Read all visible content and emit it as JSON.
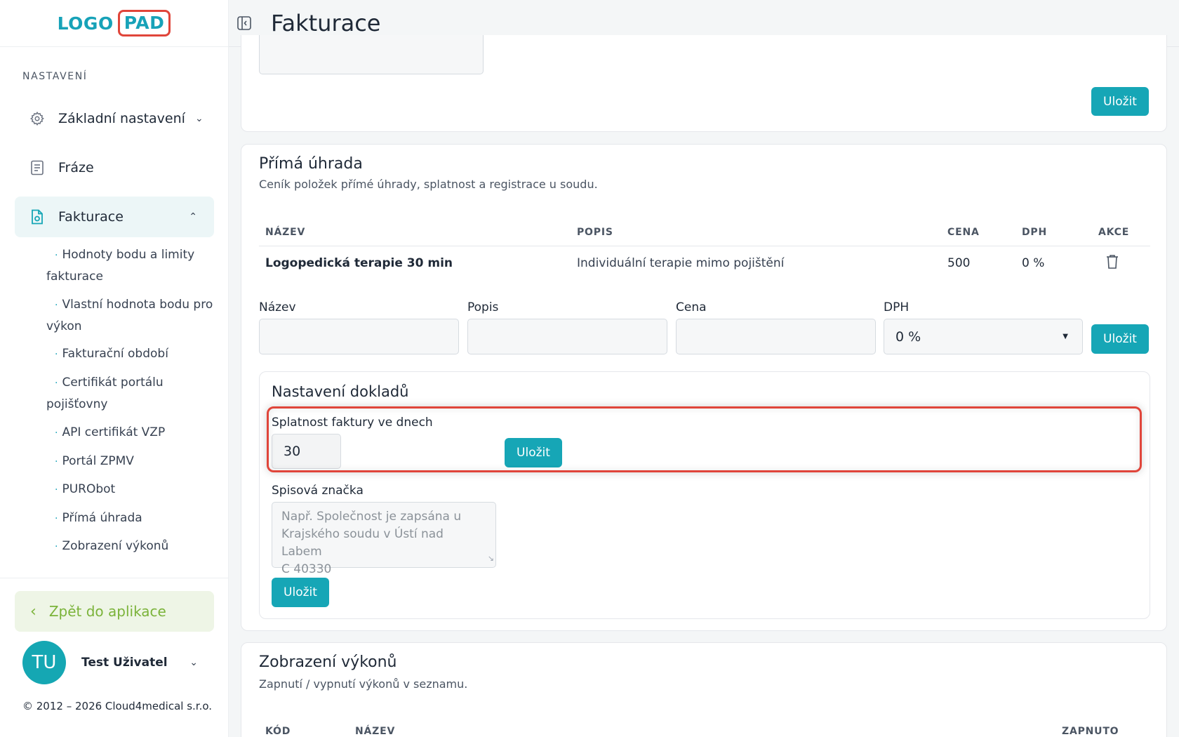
{
  "logo": {
    "part1": "LOGO",
    "part2": "PAD"
  },
  "sidebar": {
    "section_label": "NASTAVENÍ",
    "items": [
      {
        "label": "Základní nastavení",
        "icon": "gear-icon"
      },
      {
        "label": "Fráze",
        "icon": "document-icon"
      },
      {
        "label": "Fakturace",
        "icon": "invoice-icon"
      }
    ],
    "sub_items": [
      {
        "line1": "Hodnoty bodu a limity",
        "line2": "fakturace"
      },
      {
        "line1": "Vlastní hodnota bodu pro",
        "line2": "výkon"
      },
      {
        "line1": "Fakturační období",
        "line2": ""
      },
      {
        "line1": "Certifikát portálu",
        "line2": "pojišťovny"
      },
      {
        "line1": "API certifikát VZP",
        "line2": ""
      },
      {
        "line1": "Portál ZPMV",
        "line2": ""
      },
      {
        "line1": "PURObot",
        "line2": ""
      },
      {
        "line1": "Přímá úhrada",
        "line2": ""
      },
      {
        "line1": "Zobrazení výkonů",
        "line2": ""
      }
    ],
    "back_label": "Zpět do aplikace",
    "user": {
      "initials": "TU",
      "name": "Test Uživatel"
    },
    "copyright": "© 2012 – 2026 Cloud4medical s.r.o."
  },
  "header": {
    "title": "Fakturace"
  },
  "top_card": {
    "save_label": "Uložit"
  },
  "prima_uhrada": {
    "title": "Přímá úhrada",
    "subtitle": "Ceník položek přímé úhrady, splatnost a registrace u soudu.",
    "columns": {
      "name": "NÁZEV",
      "desc": "POPIS",
      "price": "CENA",
      "vat": "DPH",
      "action": "AKCE"
    },
    "rows": [
      {
        "name": "Logopedická terapie 30 min",
        "desc": "Individuální terapie mimo pojištění",
        "price": "500",
        "vat": "0 %"
      }
    ],
    "form": {
      "name_label": "Název",
      "desc_label": "Popis",
      "price_label": "Cena",
      "vat_label": "DPH",
      "vat_value": "0 %",
      "save_label": "Uložit"
    }
  },
  "nastaveni_dokladu": {
    "title": "Nastavení dokladů",
    "splatnost_label": "Splatnost faktury ve dnech",
    "splatnost_value": "30",
    "save_label": "Uložit",
    "spisova_label": "Spisová značka",
    "spisova_placeholder_lines": [
      "Např. Společnost je zapsána u",
      "Krajského soudu v Ústí nad Labem",
      "C 40330"
    ],
    "save2_label": "Uložit"
  },
  "zobrazeni": {
    "title": "Zobrazení výkonů",
    "subtitle": "Zapnutí / vypnutí výkonů v seznamu.",
    "columns": {
      "code": "KÓD",
      "name": "NÁZEV",
      "enabled": "ZAPNUTO"
    }
  }
}
